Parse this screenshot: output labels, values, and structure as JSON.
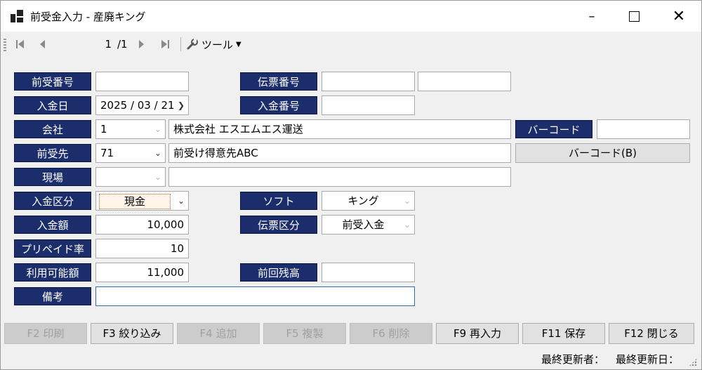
{
  "window": {
    "title": "前受金入力 - 産廃キング",
    "minimize_icon": "minimize-icon",
    "maximize_icon": "maximize-icon",
    "close_icon": "close-icon"
  },
  "toolbar": {
    "position": "1",
    "total": "/1",
    "tools_label": "ツール"
  },
  "labels": {
    "maeuke_no": "前受番号",
    "denpyo_no": "伝票番号",
    "nyukin_date": "入金日",
    "nyukin_no": "入金番号",
    "company": "会社",
    "barcode": "バーコード",
    "customer": "前受先",
    "site": "現場",
    "nyukin_kubun": "入金区分",
    "soft": "ソフト",
    "amount": "入金額",
    "denpyo_kubun": "伝票区分",
    "prepaid_rate": "プリペイド率",
    "available": "利用可能額",
    "prev_balance": "前回残高",
    "remarks": "備考"
  },
  "fields": {
    "maeuke_no": "",
    "denpyo_no_1": "",
    "denpyo_no_2": "",
    "nyukin_date": "2025 / 03 / 21",
    "nyukin_no": "",
    "company_code": "1",
    "company_name": "株式会社 エスエムエス運送",
    "barcode": "",
    "customer_code": "71",
    "customer_name": "前受け得意先ABC",
    "site_code": "",
    "site_name": "",
    "nyukin_kubun": "現金",
    "soft": "キング",
    "amount": "10,000",
    "denpyo_kubun": "前受入金",
    "prepaid_rate": "10",
    "available": "11,000",
    "prev_balance": "",
    "remarks": ""
  },
  "buttons": {
    "barcode": "バーコード(B)",
    "f2": "F2 印刷",
    "f3": "F3 絞り込み",
    "f4": "F4 追加",
    "f5": "F5 複製",
    "f6": "F6 削除",
    "f9": "F9 再入力",
    "f11": "F11 保存",
    "f12": "F12 閉じる"
  },
  "status": {
    "updated_by": "最終更新者：",
    "updated_on": "最終更新日："
  }
}
